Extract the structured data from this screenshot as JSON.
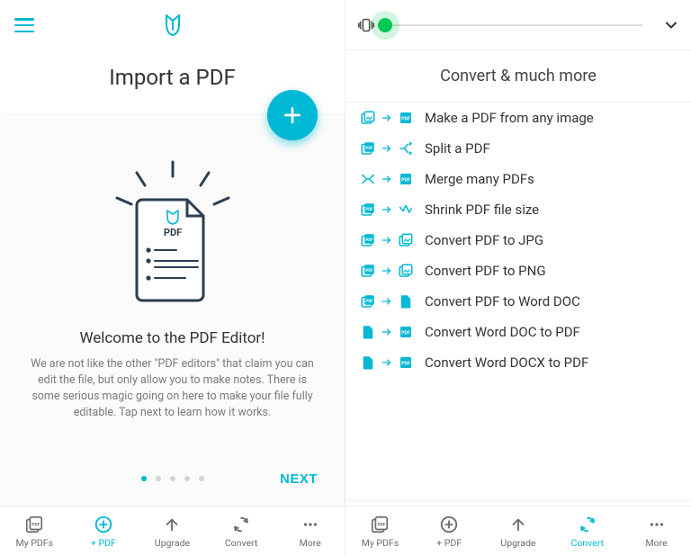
{
  "left": {
    "title": "Import a PDF",
    "welcome_title": "Welcome to the PDF Editor!",
    "welcome_desc": "We are not like the other \"PDF editors\" that claim you can edit the file, but only allow you to make notes. There is some serious magic going on here to make your file fully editable. Tap next to learn how it works.",
    "next_label": "NEXT",
    "pdf_badge": "PDF",
    "pager": {
      "count": 5,
      "active": 0
    }
  },
  "right": {
    "section_title": "Convert & much more",
    "items": [
      {
        "label": "Make a PDF from any image"
      },
      {
        "label": "Split a PDF"
      },
      {
        "label": "Merge many PDFs"
      },
      {
        "label": "Shrink PDF file size"
      },
      {
        "label": "Convert PDF to JPG"
      },
      {
        "label": "Convert PDF to PNG"
      },
      {
        "label": "Convert PDF to Word DOC"
      },
      {
        "label": "Convert Word DOC to PDF"
      },
      {
        "label": "Convert Word DOCX to PDF"
      }
    ]
  },
  "nav": {
    "items": [
      {
        "label": "My PDFs"
      },
      {
        "label": "+ PDF"
      },
      {
        "label": "Upgrade"
      },
      {
        "label": "Convert"
      },
      {
        "label": "More"
      }
    ],
    "active_left": 1,
    "active_right": 3
  },
  "colors": {
    "accent": "#00b8d4",
    "slider": "#00c853"
  }
}
